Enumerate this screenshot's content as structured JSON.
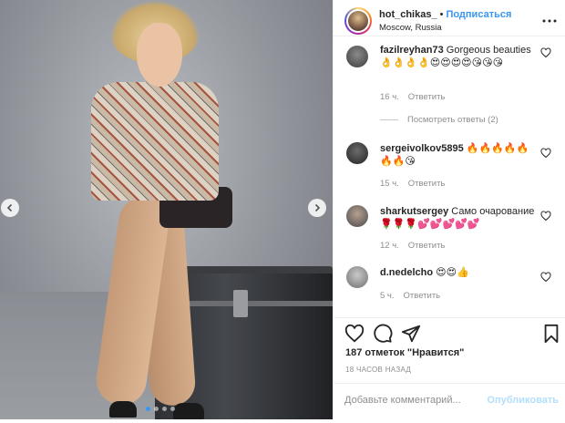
{
  "header": {
    "username": "hot_chikas_",
    "separator": "•",
    "follow_label": "Подписаться",
    "location": "Moscow, Russia",
    "more_icon": "more-options-icon"
  },
  "photo": {
    "description_icon": "post-photo",
    "slide_count": 4,
    "active_slide": 1
  },
  "comments": [
    {
      "username": "fazilreyhan73",
      "text": "Gorgeous beauties",
      "emoji": "👌👌👌👌😍😍😍😍😘😘😘",
      "time": "16 ч.",
      "reply_label": "Ответить"
    },
    {
      "username": "sergeivolkov5895",
      "text": "",
      "emoji": "🔥🔥🔥🔥🔥🔥🔥😘",
      "time": "15 ч.",
      "reply_label": "Ответить"
    },
    {
      "username": "sharkutsergey",
      "text": "Само очарование",
      "emoji": "🌹🌹🌹💕💕💕💕💕",
      "time": "12 ч.",
      "reply_label": "Ответить"
    },
    {
      "username": "d.nedelcho",
      "text": "",
      "emoji": "😍😍👍",
      "time": "5 ч.",
      "reply_label": "Ответить"
    }
  ],
  "view_replies_label": "Посмотреть ответы (2)",
  "likes_label": "187 отметок \"Нравится\"",
  "post_time": "18 ЧАСОВ НАЗАД",
  "add_comment": {
    "placeholder": "Добавьте комментарий...",
    "post_label": "Опубликовать"
  },
  "colors": {
    "accent": "#3897f0",
    "post_disabled": "#b2dffc",
    "meta": "#8e8e8e"
  }
}
